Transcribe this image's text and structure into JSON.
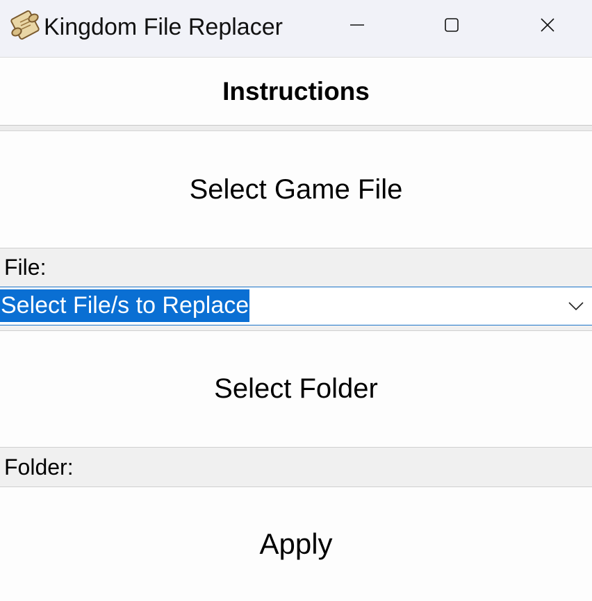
{
  "window": {
    "title": "Kingdom File Replacer",
    "icons": {
      "app": "scroll-icon",
      "minimize": "minimize-icon",
      "maximize": "maximize-icon",
      "close": "close-icon"
    }
  },
  "buttons": {
    "instructions": "Instructions",
    "select_game_file": "Select Game File",
    "select_folder": "Select Folder",
    "apply": "Apply"
  },
  "labels": {
    "file": "File:",
    "folder": "Folder:"
  },
  "file_combo": {
    "selected": "Select File/s to Replace",
    "arrow_icon": "chevron-down-icon"
  },
  "colors": {
    "titlebar_bg": "#f1f2f8",
    "selection_bg": "#0a6fd3",
    "combo_border": "#1a73c8",
    "label_bg": "#f0f0f0"
  }
}
